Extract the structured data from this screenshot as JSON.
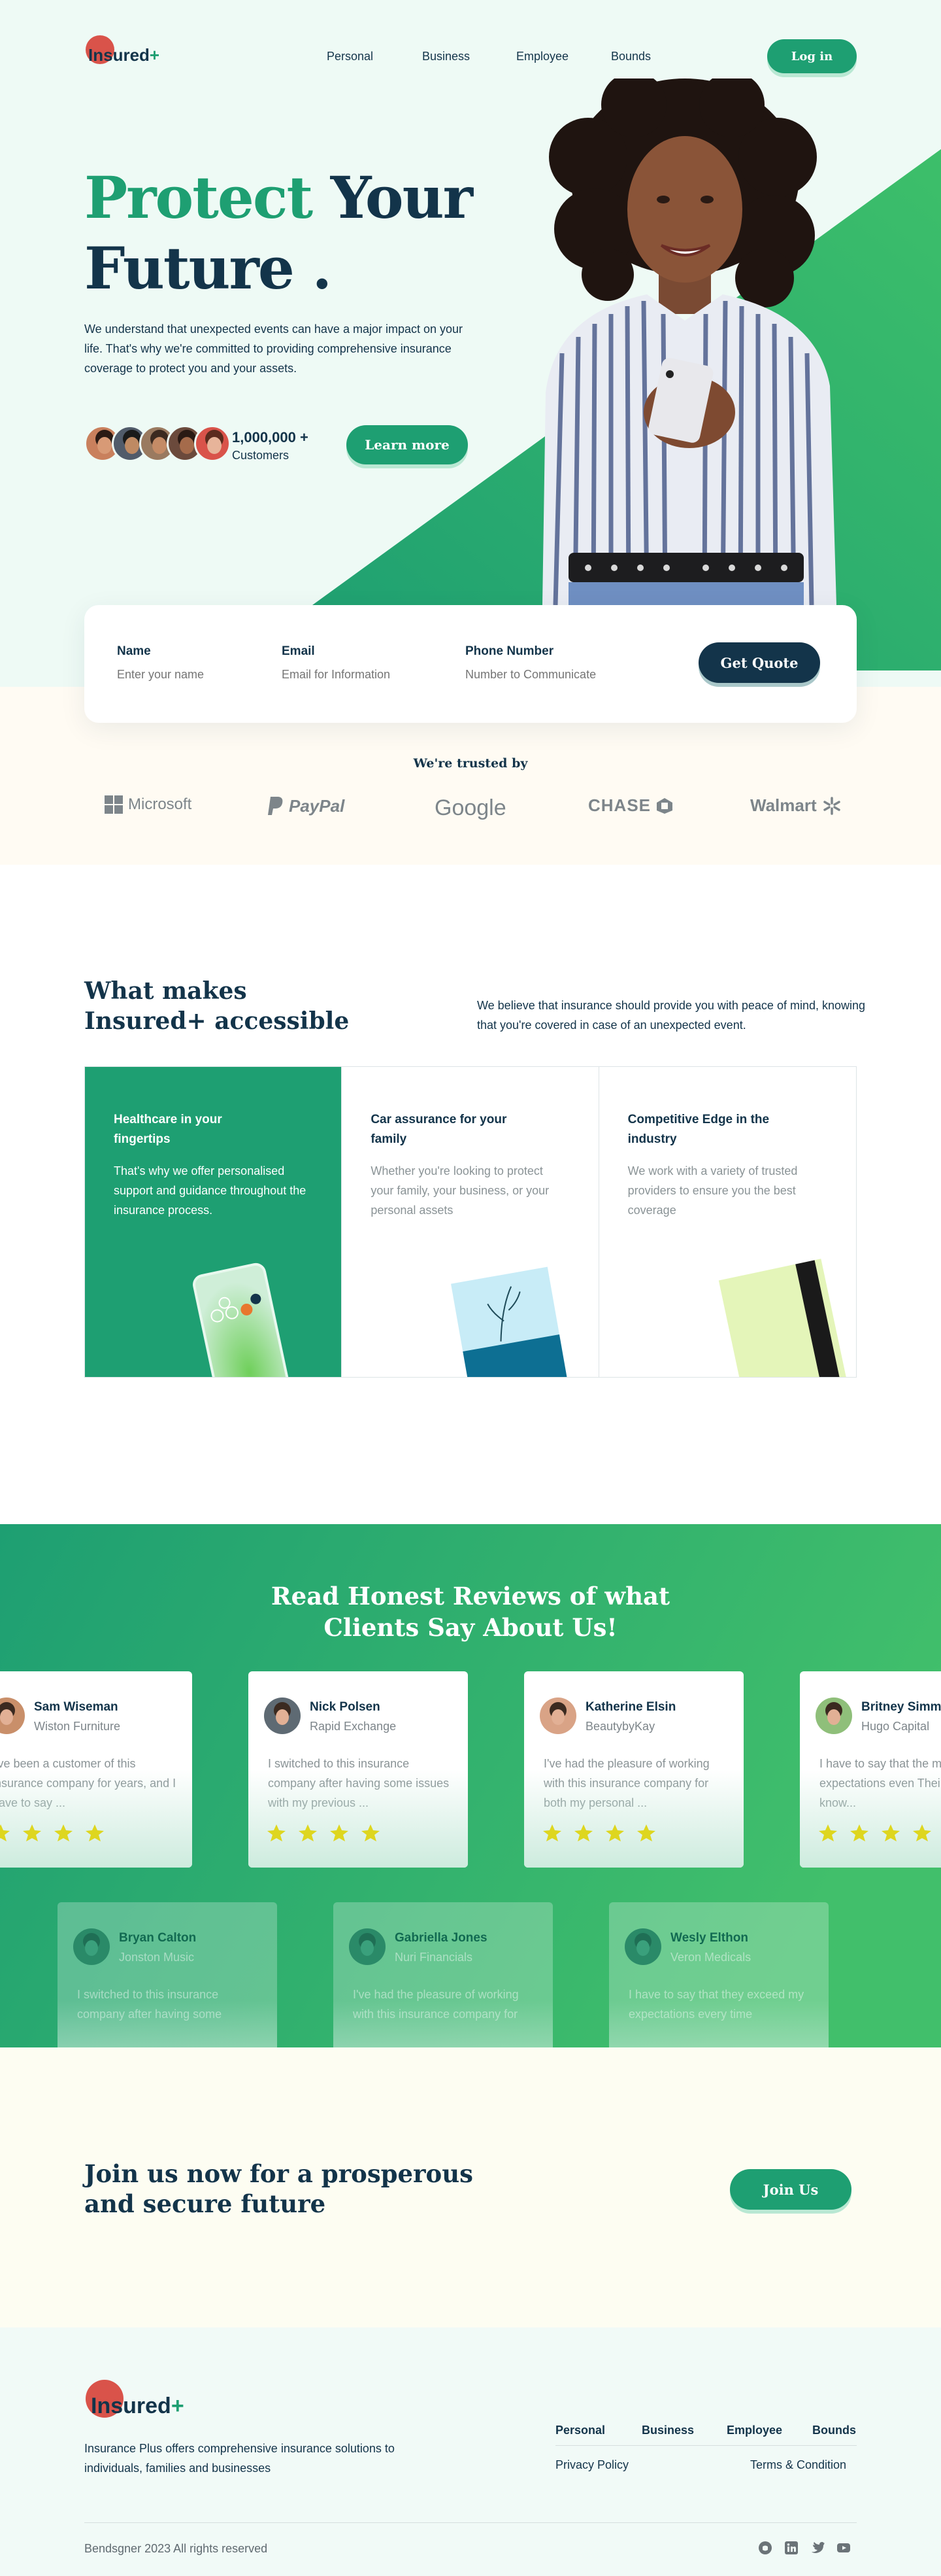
{
  "colors": {
    "accent": "#1e9f72",
    "navy": "#13344a",
    "logo_dot": "#d9534a",
    "star": "#ded61f"
  },
  "brand": {
    "name_prefix": "Insured",
    "name_suffix": "+"
  },
  "nav": {
    "items": [
      "Personal",
      "Business",
      "Employee",
      "Bounds"
    ],
    "login": "Log in"
  },
  "hero": {
    "title_green": "Protect",
    "title_rest": "Your",
    "title_line2": "Future .",
    "description": "We understand that unexpected events can have a major impact on your life. That's why we're committed to providing comprehensive insurance coverage to protect you and your assets.",
    "customers_count": "1,000,000 +",
    "customers_label": "Customers",
    "cta": "Learn more"
  },
  "quote_form": {
    "fields": [
      {
        "label": "Name",
        "placeholder": "Enter your name"
      },
      {
        "label": "Email",
        "placeholder": "Email for Information"
      },
      {
        "label": "Phone Number",
        "placeholder": "Number to Communicate"
      }
    ],
    "button": "Get Quote"
  },
  "trusted": {
    "title": "We're trusted by",
    "brands": [
      "Microsoft",
      "PayPal",
      "Google",
      "CHASE",
      "Walmart"
    ]
  },
  "features": {
    "title_line1": "What makes",
    "title_line2": "Insured+ accessible",
    "description": "We believe that insurance should provide you with peace of mind, knowing that you're covered in case of an unexpected event.",
    "cards": [
      {
        "title": "Healthcare in your fingertips",
        "text": "That's why we offer personalised support and guidance throughout the insurance process."
      },
      {
        "title": "Car assurance for your family",
        "text": "Whether you're looking to protect your family, your business, or your personal assets"
      },
      {
        "title": "Competitive Edge in the industry",
        "text": "We work with a variety of trusted providers to ensure you the best coverage"
      }
    ]
  },
  "reviews": {
    "title_line1": "Read Honest Reviews of what",
    "title_line2": "Clients Say About Us!",
    "row1": [
      {
        "name": "Sam Wiseman",
        "company": "Wiston Furniture",
        "text": "I've been a customer of this insurance company for years, and I have to say ...",
        "stars": 4
      },
      {
        "name": "Nick Polsen",
        "company": "Rapid Exchange",
        "text": "I switched to this insurance company after having some issues with my previous ...",
        "stars": 4
      },
      {
        "name": "Katherine Elsin",
        "company": "BeautybyKay",
        "text": "I've had the pleasure of working with this insurance company for both my personal ...",
        "stars": 4
      },
      {
        "name": "Britney Simmons",
        "company": "Hugo Capital",
        "text": "I have to say that the my expectations even Their agents are know...",
        "stars": 4
      }
    ],
    "row2": [
      {
        "name": "Bryan Calton",
        "company": "Jonston Music",
        "text": "I switched to this insurance company after having some"
      },
      {
        "name": "Gabriella Jones",
        "company": "Nuri Financials",
        "text": "I've had the pleasure of working with this insurance company for"
      },
      {
        "name": "Wesly Elthon",
        "company": "Veron Medicals",
        "text": "I have to say that they exceed my expectations every time"
      }
    ]
  },
  "cta": {
    "title_line1": "Join us now for a prosperous",
    "title_line2": "and secure future",
    "button": "Join Us"
  },
  "footer": {
    "description": "Insurance Plus offers comprehensive insurance solutions to individuals, families and businesses",
    "nav": [
      "Personal",
      "Business",
      "Employee",
      "Bounds"
    ],
    "privacy": "Privacy Policy",
    "terms": "Terms & Condition",
    "copyright": "Bendsgner 2023 All rights reserved",
    "social_icons": [
      "github-icon",
      "linkedin-icon",
      "twitter-icon",
      "youtube-icon"
    ]
  }
}
